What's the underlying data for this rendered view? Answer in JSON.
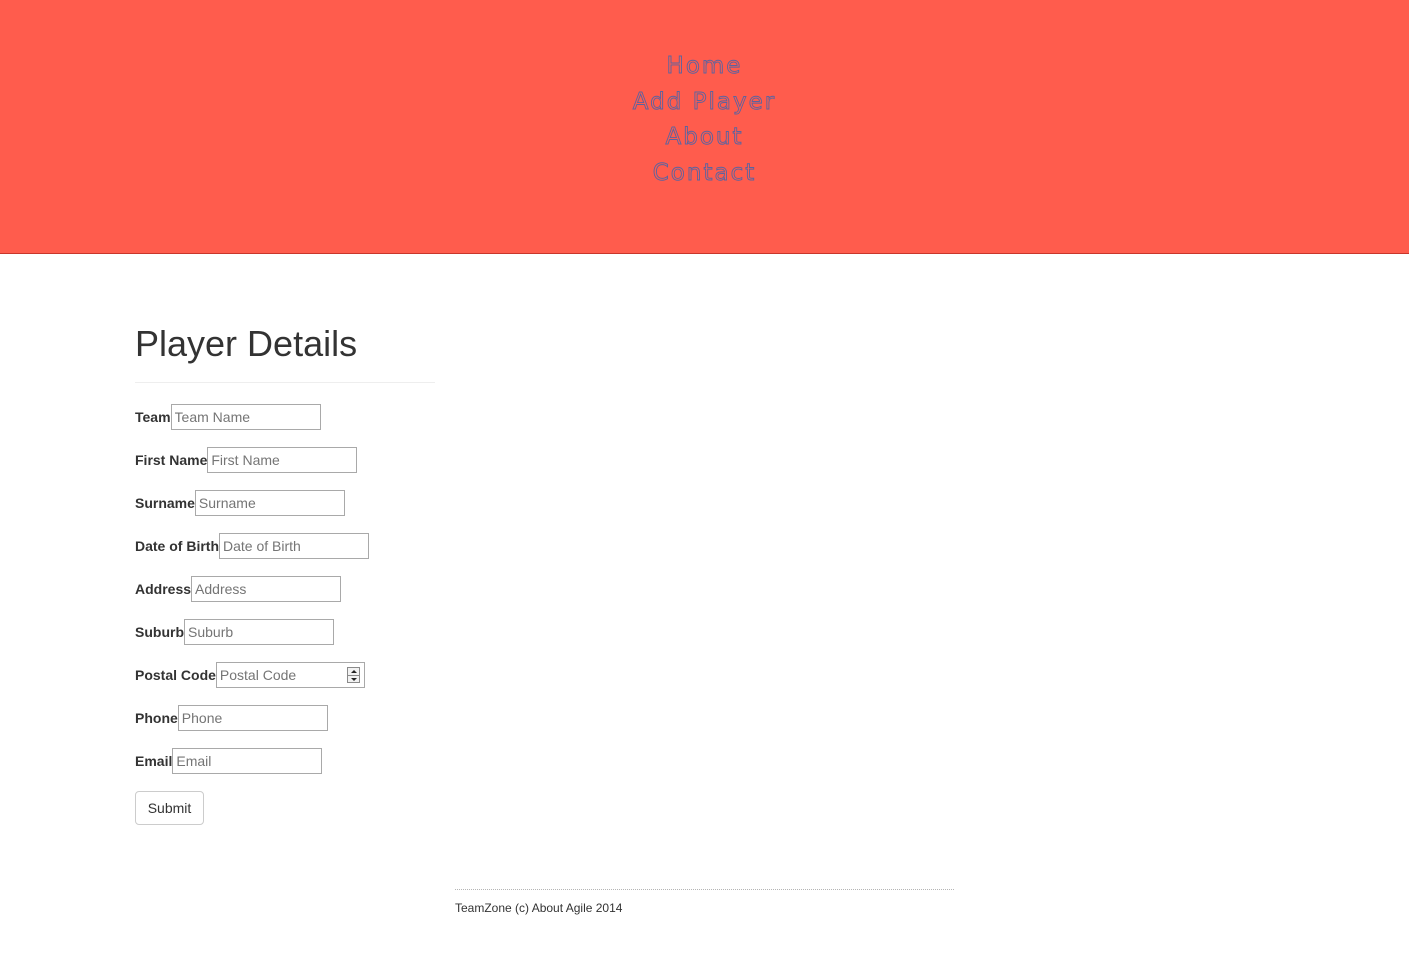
{
  "nav": {
    "items": [
      {
        "label": "Home"
      },
      {
        "label": "Add Player"
      },
      {
        "label": "About"
      },
      {
        "label": "Contact"
      }
    ]
  },
  "colors": {
    "header_bg": "#ff5c4d",
    "nav_text": "#5b63a0"
  },
  "main": {
    "title": "Player Details",
    "fields": [
      {
        "label": "Team",
        "placeholder": "Team Name"
      },
      {
        "label": "First Name",
        "placeholder": "First Name"
      },
      {
        "label": "Surname",
        "placeholder": "Surname"
      },
      {
        "label": "Date of Birth",
        "placeholder": "Date of Birth"
      },
      {
        "label": "Address",
        "placeholder": "Address"
      },
      {
        "label": "Suburb",
        "placeholder": "Suburb"
      },
      {
        "label": "Postal Code",
        "placeholder": "Postal Code"
      },
      {
        "label": "Phone",
        "placeholder": "Phone"
      },
      {
        "label": "Email",
        "placeholder": "Email"
      }
    ],
    "submit_label": "Submit"
  },
  "footer": {
    "text": "TeamZone (c) About Agile 2014"
  }
}
